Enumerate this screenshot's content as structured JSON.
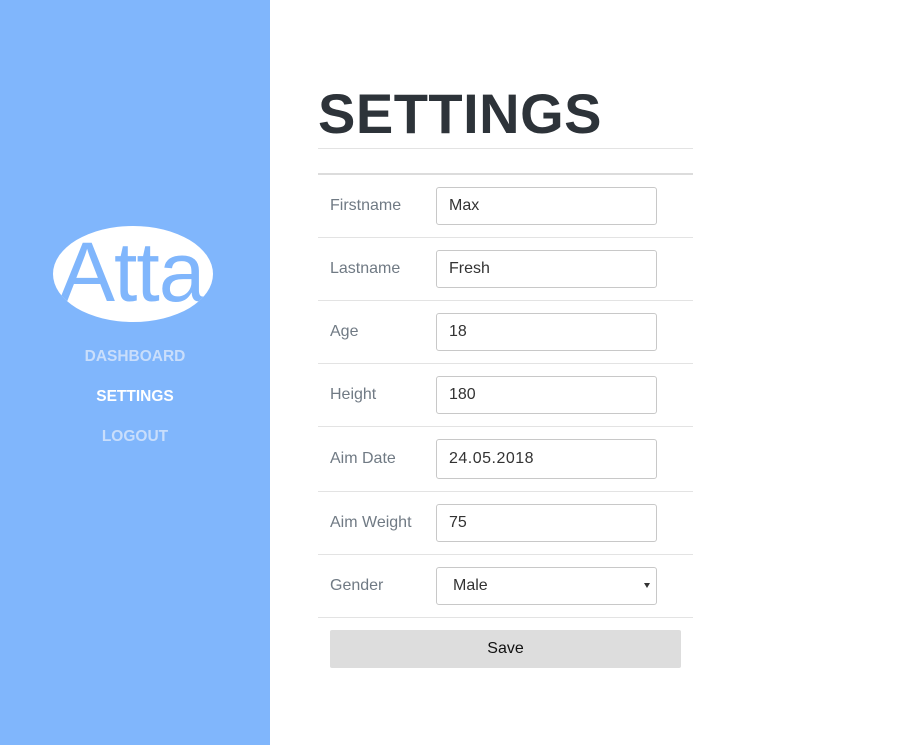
{
  "brand": {
    "logo_text": "Atta"
  },
  "nav": {
    "items": [
      {
        "label": "DASHBOARD",
        "active": false
      },
      {
        "label": "SETTINGS",
        "active": true
      },
      {
        "label": "LOGOUT",
        "active": false
      }
    ]
  },
  "page": {
    "title": "SETTINGS"
  },
  "form": {
    "fields": [
      {
        "label": "Firstname",
        "value": "Max"
      },
      {
        "label": "Lastname",
        "value": "Fresh"
      },
      {
        "label": "Age",
        "value": "18"
      },
      {
        "label": "Height",
        "value": "180"
      },
      {
        "label": "Aim Date",
        "value": "24.05.2018"
      },
      {
        "label": "Aim Weight",
        "value": "75"
      },
      {
        "label": "Gender",
        "value": "Male"
      }
    ],
    "save_label": "Save"
  },
  "colors": {
    "sidebar_bg": "#80b6fc",
    "nav_active": "#ffffff",
    "nav_inactive": "#c9defb",
    "title": "#2d3339",
    "save_bg": "#dddddd"
  }
}
